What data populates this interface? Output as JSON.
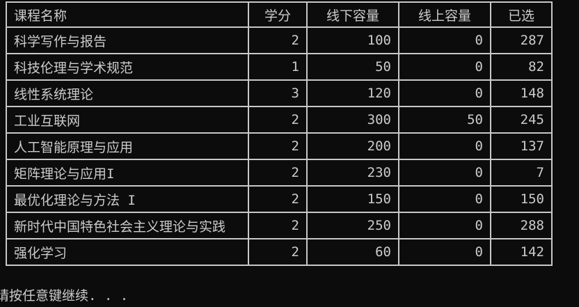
{
  "console": {
    "prompt": "请按任意键继续. . ."
  },
  "table": {
    "headers": [
      "课程名称",
      "学分",
      "线下容量",
      "线上容量",
      "已选"
    ],
    "rows": [
      [
        "科学写作与报告",
        "2",
        "100",
        "0",
        "287"
      ],
      [
        "科技伦理与学术规范",
        "1",
        "50",
        "0",
        "82"
      ],
      [
        "线性系统理论",
        "3",
        "120",
        "0",
        "148"
      ],
      [
        "工业互联网",
        "2",
        "300",
        "50",
        "245"
      ],
      [
        "人工智能原理与应用",
        "2",
        "200",
        "0",
        "137"
      ],
      [
        "矩阵理论与应用I",
        "2",
        "230",
        "0",
        "7"
      ],
      [
        "最优化理论与方法 I",
        "2",
        "150",
        "0",
        "150"
      ],
      [
        "新时代中国特色社会主义理论与实践",
        "2",
        "250",
        "0",
        "288"
      ],
      [
        "强化学习",
        "2",
        "60",
        "0",
        "142"
      ]
    ]
  },
  "colors": {
    "background": "#0c0c0c",
    "text": "#cccccc",
    "border": "#c8c8c8"
  }
}
